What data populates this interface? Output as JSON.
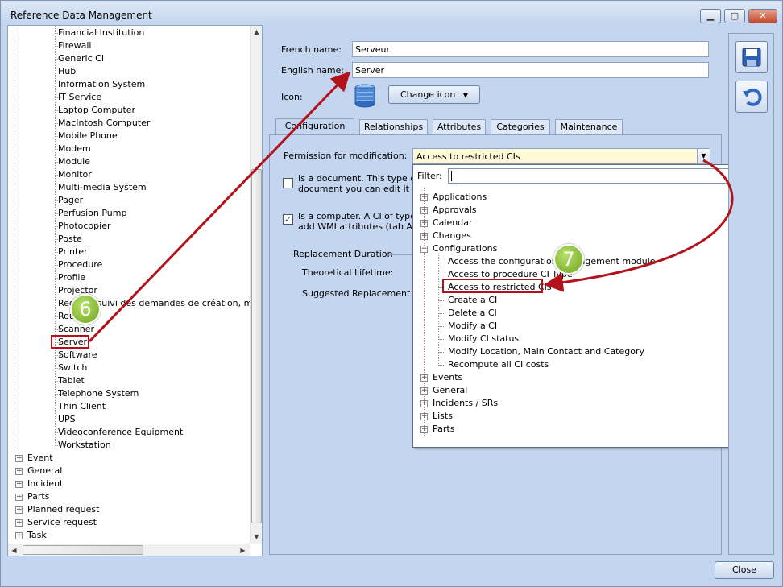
{
  "window": {
    "title": "Reference Data Management",
    "minimize_glyph": "▁",
    "maximize_glyph": "▢",
    "close_glyph": "✕"
  },
  "tree": {
    "children": [
      "Financial Institution",
      "Firewall",
      "Generic CI",
      "Hub",
      "Information System",
      "IT Service",
      "Laptop Computer",
      "MacIntosh Computer",
      "Mobile Phone",
      "Modem",
      "Module",
      "Monitor",
      "Multi-media System",
      "Pager",
      "Perfusion Pump",
      "Photocopier",
      "Poste",
      "Printer",
      "Procedure",
      "Profile",
      "Projector",
      "Registre suivi des demandes de création, mod",
      "Router",
      "Scanner",
      "Server",
      "Software",
      "Switch",
      "Tablet",
      "Telephone System",
      "Thin Client",
      "UPS",
      "Videoconference Equipment",
      "Workstation"
    ],
    "roots": [
      "Event",
      "General",
      "Incident",
      "Parts",
      "Planned request",
      "Service request",
      "Task"
    ]
  },
  "form": {
    "french_label": "French name:",
    "french_value": "Serveur",
    "english_label": "English name:",
    "english_value": "Server",
    "icon_label": "Icon:",
    "change_icon": "Change icon",
    "permission_label": "Permission for modification:",
    "permission_value": "Access to restricted CIs",
    "doc_text_1": "Is a document. This type of C",
    "doc_text_2": "document you can edit it dire",
    "computer_text_1": "Is a computer. A CI of type 'co",
    "computer_text_2": "add WMI attributes (tab Attrib",
    "replacement_heading": "Replacement Duration",
    "lifetime_label": "Theoretical Lifetime:",
    "suggested_label": "Suggested Replacement Va"
  },
  "tabs": [
    "Configuration",
    "Relationships",
    "Attributes",
    "Categories",
    "Maintenance"
  ],
  "dropdown": {
    "filter_label": "Filter:",
    "top_nodes_before": [
      "Applications",
      "Approvals",
      "Calendar",
      "Changes",
      "Configurations"
    ],
    "config_children": [
      "Access the configuration management module",
      "Access to procedure CI Type",
      "Access to restricted CIs",
      "Create a CI",
      "Delete a CI",
      "Modify a CI",
      "Modify CI status",
      "Modify Location, Main Contact and Category",
      "Recompute all CI costs"
    ],
    "top_nodes_after": [
      "Events",
      "General",
      "Incidents / SRs",
      "Lists",
      "Parts"
    ]
  },
  "annotations": {
    "badge_6": "6",
    "badge_7": "7",
    "accent": "#b3121b",
    "badge_color": "#7fb32a"
  },
  "footer": {
    "close": "Close"
  },
  "icons": {
    "save": "save-icon",
    "undo": "undo-icon",
    "server": "server-icon"
  }
}
